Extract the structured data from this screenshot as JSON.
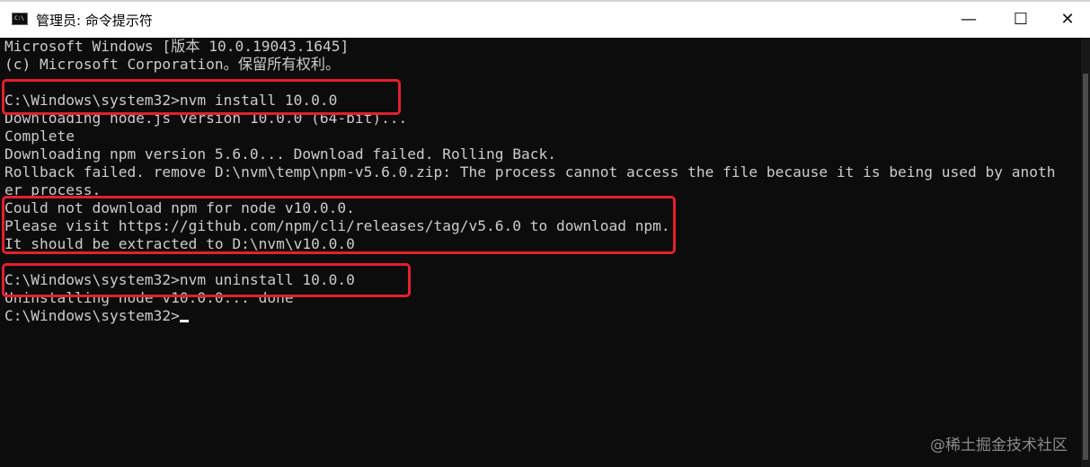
{
  "window": {
    "title": "管理员: 命令提示符",
    "icon_label": "C:\\",
    "minimize_glyph": "—",
    "maximize_glyph": "☐",
    "close_glyph": "✕"
  },
  "console": {
    "lines": [
      "Microsoft Windows [版本 10.0.19043.1645]",
      "(c) Microsoft Corporation。保留所有权利。",
      "",
      "C:\\Windows\\system32>nvm install 10.0.0",
      "Downloading node.js version 10.0.0 (64-bit)...",
      "Complete",
      "Downloading npm version 5.6.0... Download failed. Rolling Back.",
      "Rollback failed. remove D:\\nvm\\temp\\npm-v5.6.0.zip: The process cannot access the file because it is being used by anoth",
      "er process.",
      "Could not download npm for node v10.0.0.",
      "Please visit https://github.com/npm/cli/releases/tag/v5.6.0 to download npm.",
      "It should be extracted to D:\\nvm\\v10.0.0",
      "",
      "C:\\Windows\\system32>nvm uninstall 10.0.0",
      "Uninstalling node v10.0.0... done",
      "C:\\Windows\\system32>"
    ]
  },
  "watermark": "@稀土掘金技术社区",
  "colors": {
    "console_bg": "#0c0c0c",
    "console_text": "#cccccc",
    "highlight_box": "#e2202e",
    "titlebar_bg": "#ffffff"
  }
}
